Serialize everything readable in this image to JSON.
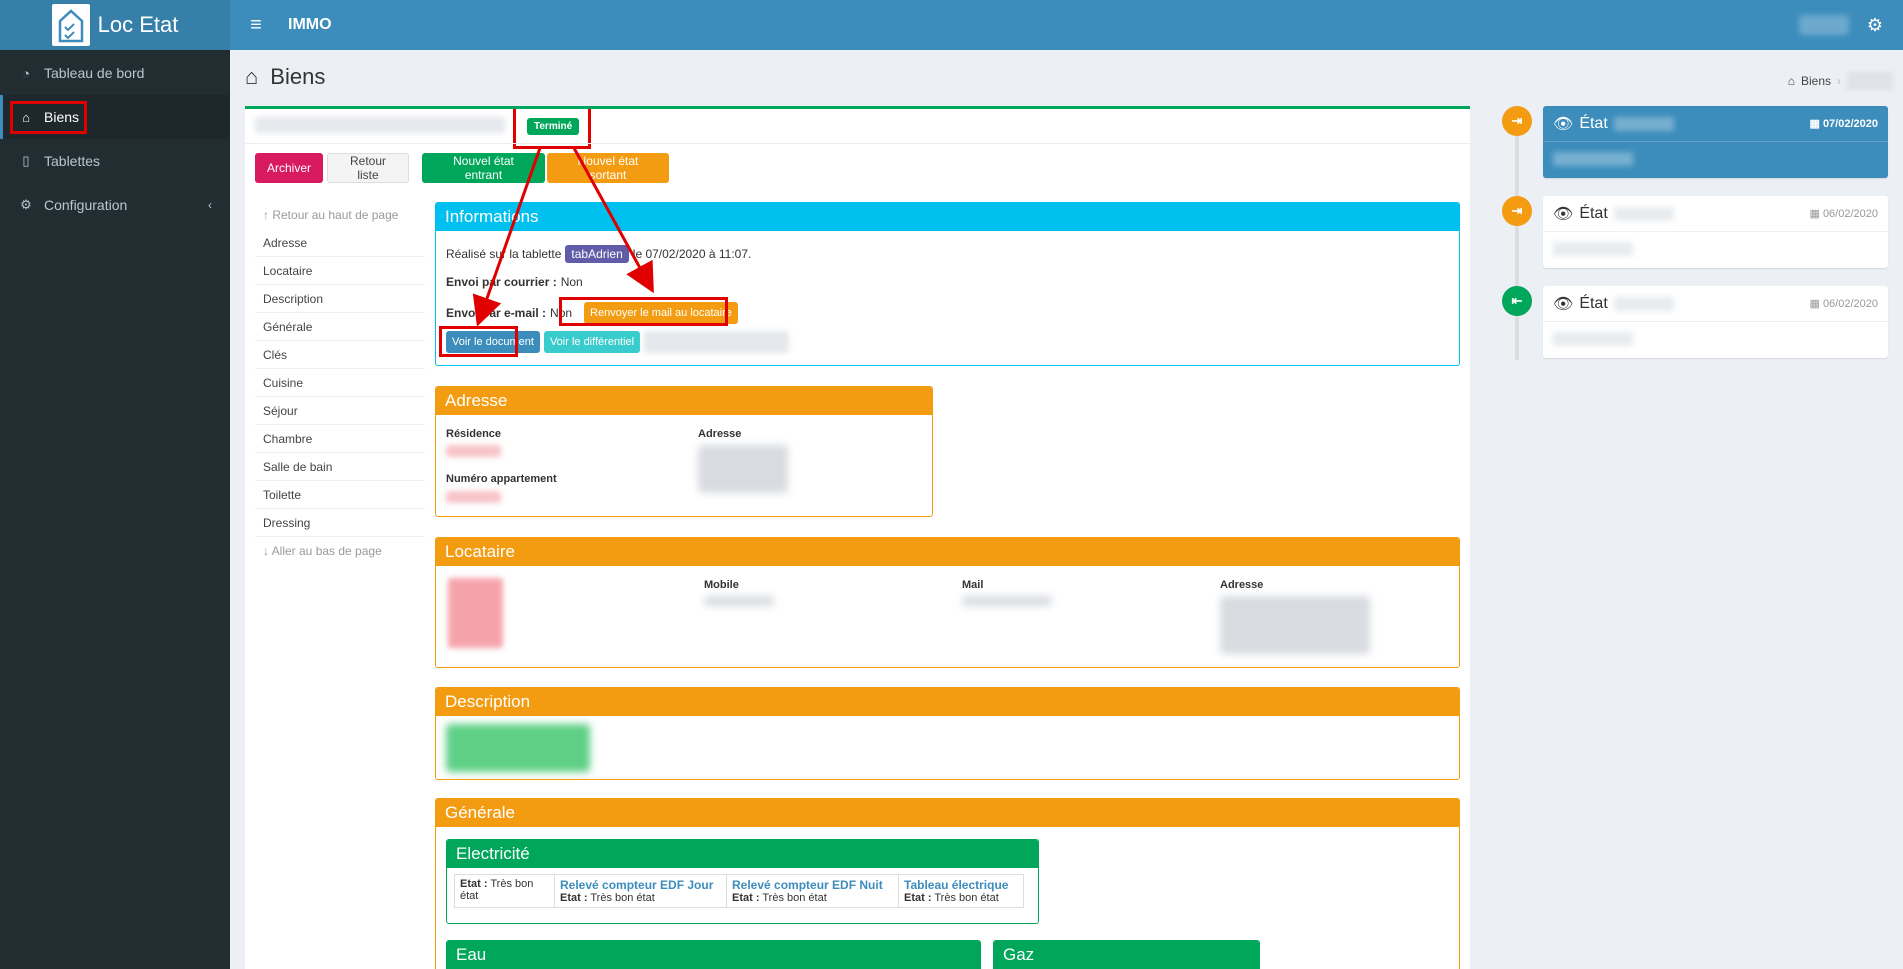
{
  "app": {
    "name": "Loc Etat",
    "brand": "IMMO"
  },
  "sidebar": {
    "items": [
      {
        "label": "Tableau de bord",
        "icon": "dashboard-icon"
      },
      {
        "label": "Biens",
        "icon": "home-icon"
      },
      {
        "label": "Tablettes",
        "icon": "tablet-icon"
      },
      {
        "label": "Configuration",
        "icon": "gears-icon"
      }
    ]
  },
  "page": {
    "title": "Biens",
    "breadcrumb": "Biens",
    "status_badge": "Terminé"
  },
  "actions": {
    "archive": "Archiver",
    "back": "Retour liste",
    "new_in": "Nouvel état entrant",
    "new_out": "Nouvel état sortant"
  },
  "toc": {
    "top": "Retour au haut de page",
    "items": [
      "Adresse",
      "Locataire",
      "Description",
      "Générale",
      "Clés",
      "Cuisine",
      "Séjour",
      "Chambre",
      "Salle de bain",
      "Toilette",
      "Dressing"
    ],
    "bottom": "Aller au bas de page"
  },
  "informations": {
    "title": "Informations",
    "made_on": "Réalisé sur la tablette",
    "tablet": "tabAdrien",
    "date_text": "le 07/02/2020 à 11:07.",
    "mail_post_label": "Envoi par courrier :",
    "mail_post_value": "Non",
    "mail_email_label": "Envoi par e-mail :",
    "mail_email_value": "Non",
    "resend_button": "Renvoyer le mail au locataire",
    "doc_button": "Voir le document",
    "diff_button": "Voir le différentiel"
  },
  "adresse": {
    "title": "Adresse",
    "residence_label": "Résidence",
    "adresse_label": "Adresse",
    "appartement_label": "Numéro appartement"
  },
  "locataire": {
    "title": "Locataire",
    "mobile_label": "Mobile",
    "mail_label": "Mail",
    "adresse_label": "Adresse"
  },
  "description": {
    "title": "Description"
  },
  "generale": {
    "title": "Générale",
    "electricite": {
      "title": "Electricité",
      "etat_label": "Etat :",
      "etat_value": "Très bon état",
      "cols": [
        {
          "title": "Relevé compteur EDF Jour",
          "etat": "Très bon état"
        },
        {
          "title": "Relevé compteur EDF Nuit",
          "etat": "Très bon état"
        },
        {
          "title": "Tableau électrique",
          "etat": "Très bon état"
        }
      ]
    },
    "eau": {
      "title": "Eau"
    },
    "gaz": {
      "title": "Gaz"
    }
  },
  "timeline": [
    {
      "label": "État",
      "date": "07/02/2020",
      "color": "#f39c12"
    },
    {
      "label": "État",
      "date": "06/02/2020",
      "color": "#f39c12"
    },
    {
      "label": "État",
      "date": "06/02/2020",
      "color": "#00a65a"
    }
  ],
  "colors": {
    "primary": "#3c8dbc",
    "success": "#00a65a",
    "warning": "#f39c12",
    "info": "#00c0ef",
    "danger": "#d81b60",
    "sidebar": "#222d32"
  }
}
